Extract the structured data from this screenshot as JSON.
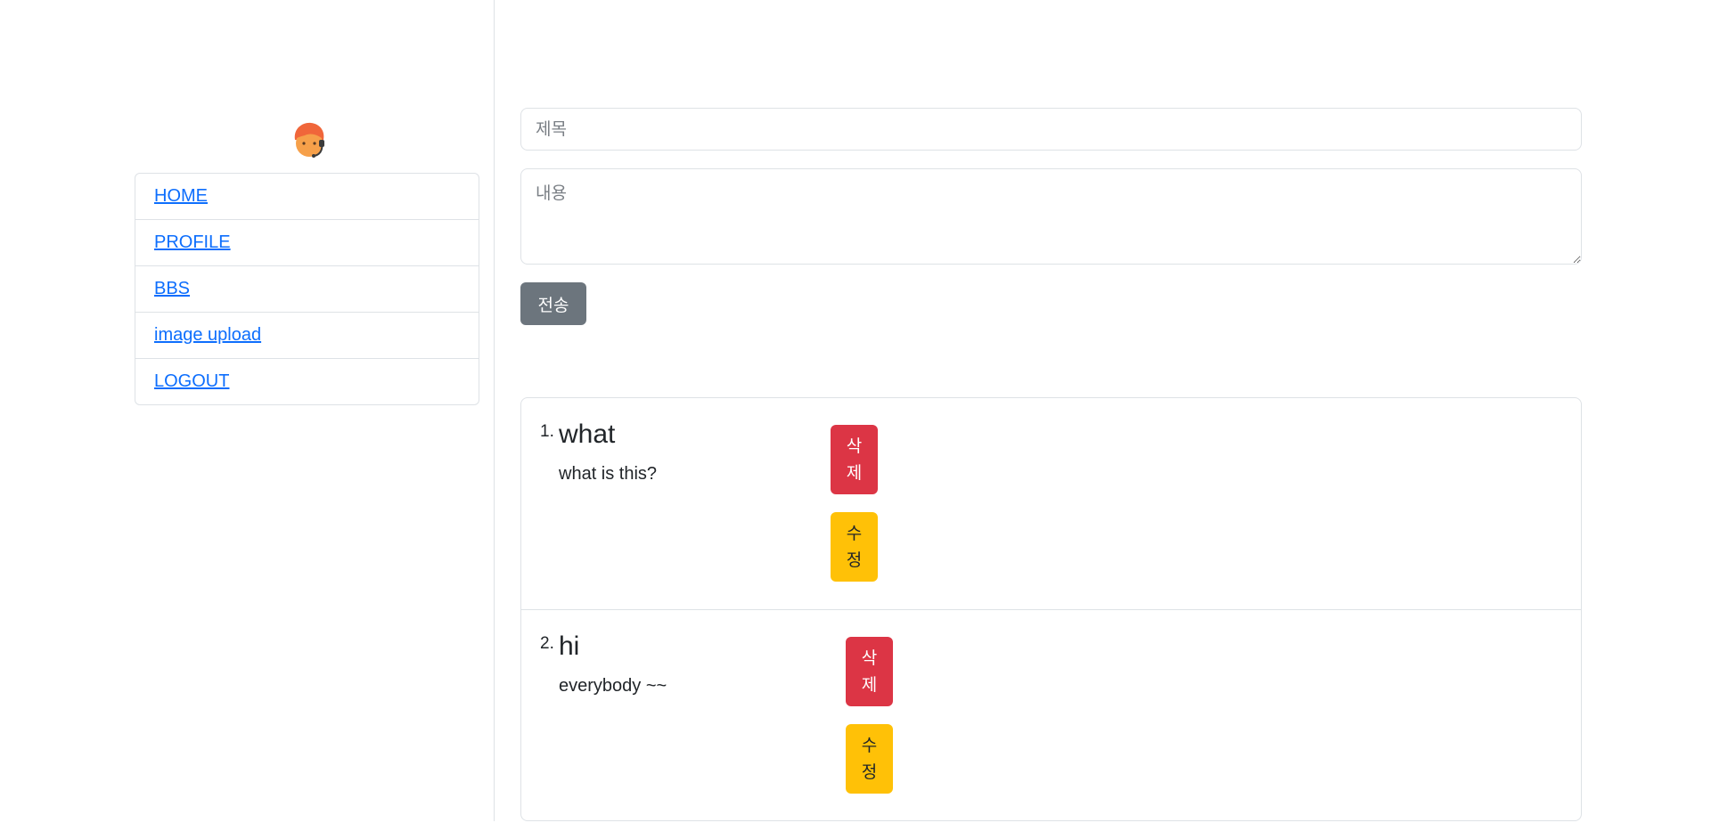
{
  "sidebar": {
    "avatar_icon": "support-agent-icon",
    "nav": [
      {
        "label": "HOME"
      },
      {
        "label": "PROFILE"
      },
      {
        "label": "BBS"
      },
      {
        "label": "image upload"
      },
      {
        "label": "LOGOUT"
      }
    ]
  },
  "form": {
    "title_placeholder": "제목",
    "content_placeholder": "내용",
    "submit_label": "전송"
  },
  "posts": [
    {
      "number": "1.",
      "title": "what",
      "body": "what is this?",
      "delete_label": "삭제",
      "edit_label": "수정"
    },
    {
      "number": "2.",
      "title": "hi",
      "body": "everybody ~~",
      "delete_label": "삭제",
      "edit_label": "수정"
    }
  ],
  "colors": {
    "link": "#0d6efd",
    "secondary": "#6c757d",
    "danger": "#dc3545",
    "warning": "#ffc107",
    "border": "#dee2e6"
  }
}
